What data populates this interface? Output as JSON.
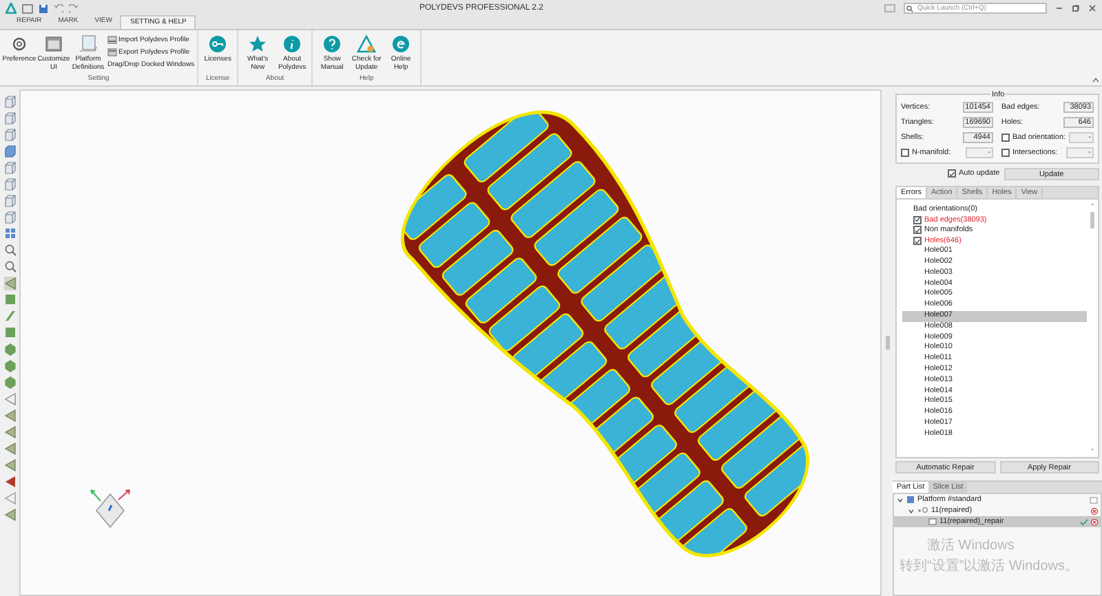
{
  "window": {
    "title": "POLYDEVS PROFESSIONAL 2.2"
  },
  "quick_launch": {
    "placeholder": "Quick Launch (Ctrl+Q)"
  },
  "tabs": [
    {
      "label": "REPAIR",
      "selected": false
    },
    {
      "label": "MARK",
      "selected": false
    },
    {
      "label": "VIEW",
      "selected": false
    },
    {
      "label": "SETTING & HELP",
      "selected": true
    }
  ],
  "ribbon_groups": [
    {
      "label": "Setting",
      "buttons": [
        "Preference",
        "Customize UI",
        "Platform Definitions"
      ],
      "small_buttons": [
        "Import Polydevs Profile",
        "Export Polydevs Profile",
        "Drag/Drop Docked Windows"
      ]
    },
    {
      "label": "License",
      "buttons": [
        "Licenses"
      ]
    },
    {
      "label": "About",
      "buttons": [
        "What's New",
        "About Polydevs"
      ]
    },
    {
      "label": "Help",
      "buttons": [
        "Show Manual",
        "Check for Update",
        "Online Help"
      ]
    }
  ],
  "info": {
    "title": "Info",
    "fields": [
      {
        "kind": "number",
        "label": "Vertices:",
        "value": "101454"
      },
      {
        "kind": "number",
        "label": "Bad edges:",
        "value": "38093"
      },
      {
        "kind": "number",
        "label": "Triangles:",
        "value": "169690"
      },
      {
        "kind": "number",
        "label": "Holes:",
        "value": "646"
      },
      {
        "kind": "number",
        "label": "Shells:",
        "value": "4944"
      },
      {
        "kind": "check",
        "label": "Bad orientation:",
        "checked": false,
        "value": "-"
      },
      {
        "kind": "check",
        "label": "N-manifold:",
        "checked": false,
        "value": "-"
      },
      {
        "kind": "check",
        "label": "Intersections:",
        "checked": false,
        "value": "-"
      }
    ]
  },
  "auto_update": {
    "label": "Auto update",
    "checked": true
  },
  "update_button": "Update",
  "panel_tabs": [
    {
      "label": "Errors",
      "selected": true
    },
    {
      "label": "Action",
      "selected": false
    },
    {
      "label": "Shells",
      "selected": false
    },
    {
      "label": "Holes",
      "selected": false
    },
    {
      "label": "View",
      "selected": false
    }
  ],
  "errors": [
    {
      "kind": "plain",
      "label": "Bad orientations(0)",
      "flagged": false
    },
    {
      "kind": "check",
      "label": "Bad edges(38093)",
      "checked": true,
      "flagged": true
    },
    {
      "kind": "check",
      "label": "Non manifolds",
      "checked": true,
      "flagged": false
    },
    {
      "kind": "check",
      "label": "Holes(646)",
      "checked": true,
      "flagged": true,
      "children": [
        {
          "label": "Hole001",
          "selected": false
        },
        {
          "label": "Hole002",
          "selected": false
        },
        {
          "label": "Hole003",
          "selected": false
        },
        {
          "label": "Hole004",
          "selected": false
        },
        {
          "label": "Hole005",
          "selected": false
        },
        {
          "label": "Hole006",
          "selected": false
        },
        {
          "label": "Hole007",
          "selected": true
        },
        {
          "label": "Hole008",
          "selected": false
        },
        {
          "label": "Hole009",
          "selected": false
        },
        {
          "label": "Hole010",
          "selected": false
        },
        {
          "label": "Hole011",
          "selected": false
        },
        {
          "label": "Hole012",
          "selected": false
        },
        {
          "label": "Hole013",
          "selected": false
        },
        {
          "label": "Hole014",
          "selected": false
        },
        {
          "label": "Hole015",
          "selected": false
        },
        {
          "label": "Hole016",
          "selected": false
        },
        {
          "label": "Hole017",
          "selected": false
        },
        {
          "label": "Hole018",
          "selected": false
        }
      ]
    }
  ],
  "repair_buttons": [
    "Automatic Repair",
    "Apply Repair"
  ],
  "list_tabs": [
    {
      "label": "Part List",
      "selected": true
    },
    {
      "label": "Slice List",
      "selected": false
    }
  ],
  "parts": [
    {
      "label": "Platform #standard",
      "expanded": true,
      "selected": false,
      "children": [
        {
          "label": "11(repaired)",
          "expanded": true,
          "selected": false,
          "children": [
            {
              "label": "11(repaired)_repair",
              "selected": true
            }
          ]
        }
      ]
    }
  ],
  "activation_notice": {
    "title": "激活 Windows",
    "detail": "转到“设置”以激活 Windows。"
  }
}
